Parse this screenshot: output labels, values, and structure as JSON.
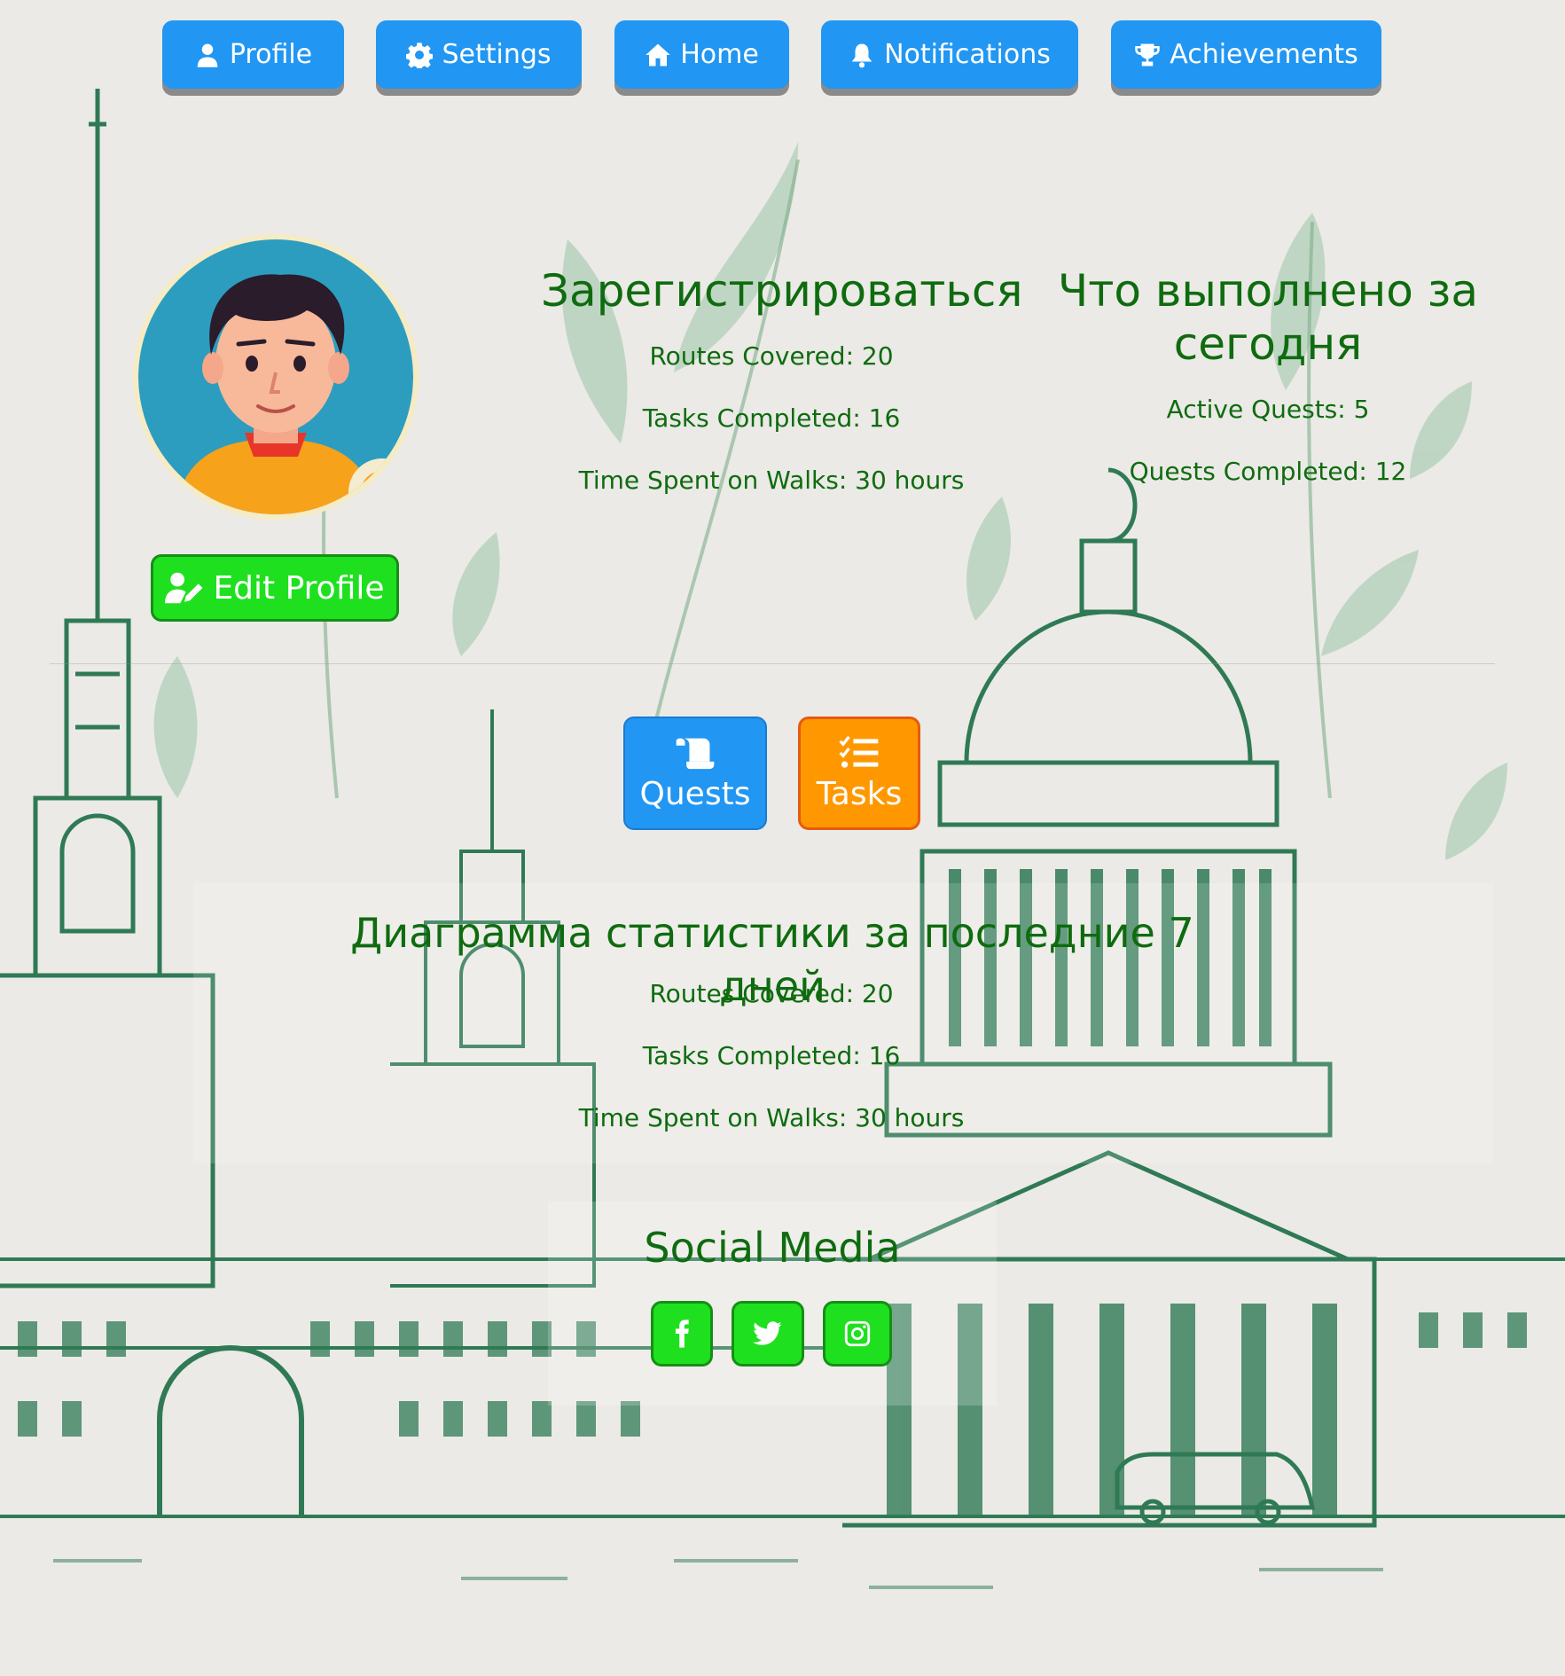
{
  "nav": {
    "profile": "Profile",
    "settings": "Settings",
    "home": "Home",
    "notifications": "Notifications",
    "achievements": "Achievements"
  },
  "profile": {
    "edit_label": "Edit Profile"
  },
  "register_block": {
    "title": "Зарегистрироваться",
    "routes": "Routes Covered: 20",
    "tasks": "Tasks Completed: 16",
    "time": "Time Spent on Walks: 30 hours"
  },
  "today_block": {
    "title_line1": "Что выполнено за",
    "title_line2": "сегодня",
    "active": "Active Quests: 5",
    "completed": "Quests Completed: 12"
  },
  "actions": {
    "quests": "Quests",
    "tasks": "Tasks"
  },
  "weekly_block": {
    "title": "Диаграмма статистики за последние 7 дней",
    "routes": "Routes Covered: 20",
    "tasks": "Tasks Completed: 16",
    "time": "Time Spent on Walks: 30 hours"
  },
  "social": {
    "title": "Social Media",
    "links": [
      "facebook-icon",
      "twitter-icon",
      "instagram-icon"
    ]
  },
  "colors": {
    "primary": "#2196f3",
    "success": "#1fe01f",
    "warning": "#ff9800",
    "text_green": "#0f6b0f"
  }
}
